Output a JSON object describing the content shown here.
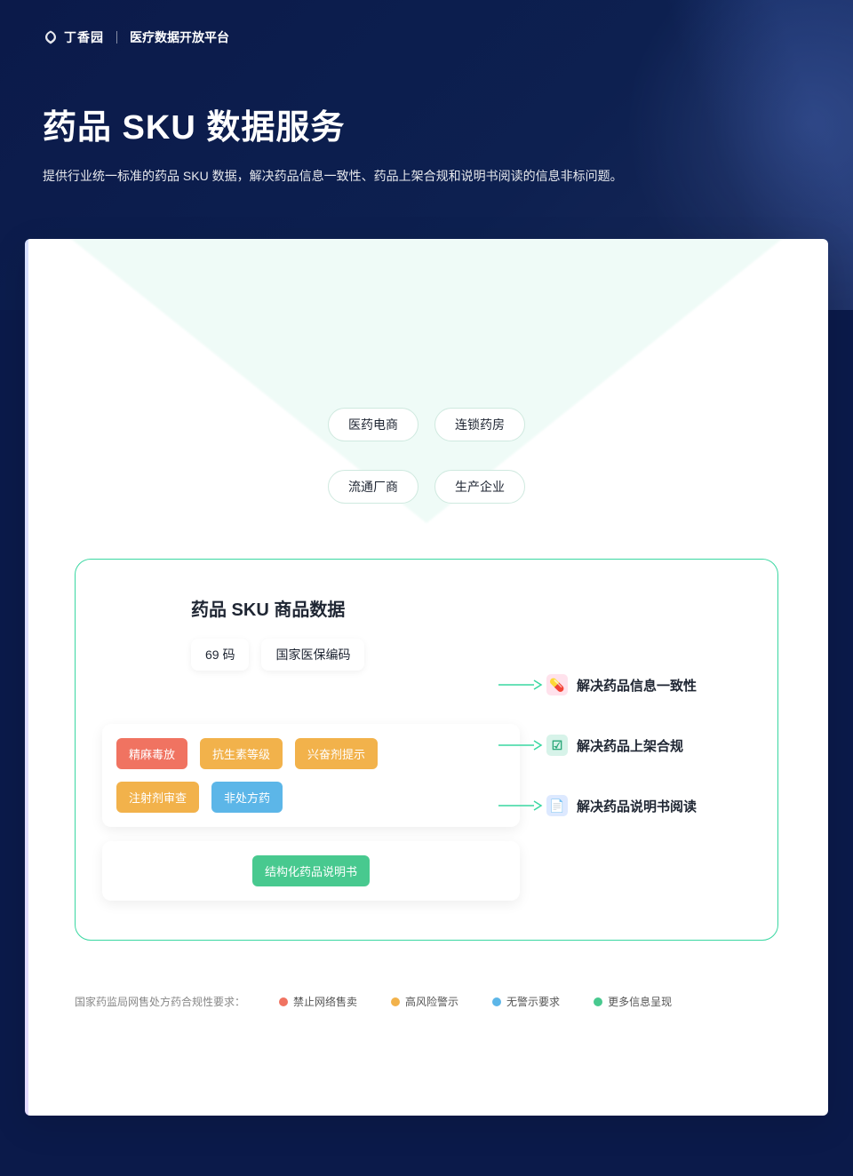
{
  "header": {
    "brand": "丁香园",
    "platform": "医疗数据开放平台"
  },
  "hero": {
    "title": "药品 SKU 数据服务",
    "subtitle": "提供行业统一标准的药品 SKU 数据，解决药品信息一致性、药品上架合规和说明书阅读的信息非标问题。"
  },
  "funnel": {
    "row1": [
      "医药电商",
      "连锁药房"
    ],
    "row2": [
      "流通厂商",
      "生产企业"
    ]
  },
  "greenbox": {
    "title": "药品 SKU 商品数据",
    "codes": [
      "69 码",
      "国家医保编码"
    ],
    "panel1_row1": [
      "精麻毒放",
      "抗生素等级",
      "兴奋剂提示"
    ],
    "panel1_row2": [
      "注射剂审查",
      "非处方药"
    ],
    "panel2": "结构化药品说明书",
    "benefits": [
      "解决药品信息一致性",
      "解决药品上架合规",
      "解决药品说明书阅读"
    ]
  },
  "legend": {
    "label": "国家药监局网售处方药合规性要求：",
    "items": [
      "禁止网络售卖",
      "高风险警示",
      "无警示要求",
      "更多信息呈现"
    ]
  }
}
